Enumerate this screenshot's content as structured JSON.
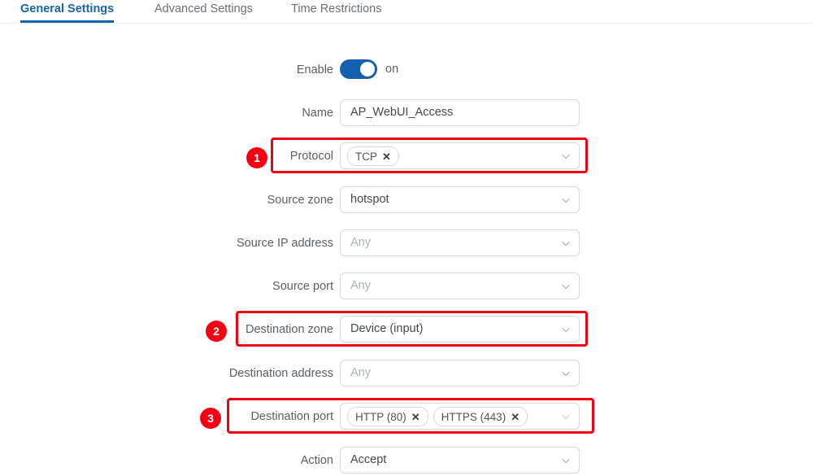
{
  "tabs": [
    {
      "label": "General Settings",
      "active": true
    },
    {
      "label": "Advanced Settings",
      "active": false
    },
    {
      "label": "Time Restrictions",
      "active": false
    }
  ],
  "form": {
    "enable": {
      "label": "Enable",
      "state_text": "on",
      "on": true
    },
    "name": {
      "label": "Name",
      "value": "AP_WebUI_Access"
    },
    "protocol": {
      "label": "Protocol",
      "chips": [
        "TCP"
      ],
      "remove_glyph": "✕"
    },
    "source_zone": {
      "label": "Source zone",
      "value": "hotspot"
    },
    "source_ip_address": {
      "label": "Source IP address",
      "placeholder": "Any"
    },
    "source_port": {
      "label": "Source port",
      "placeholder": "Any"
    },
    "destination_zone": {
      "label": "Destination zone",
      "value": "Device (input)"
    },
    "destination_address": {
      "label": "Destination address",
      "placeholder": "Any"
    },
    "destination_port": {
      "label": "Destination port",
      "chips": [
        "HTTP (80)",
        "HTTPS (443)"
      ],
      "remove_glyph": "✕"
    },
    "action": {
      "label": "Action",
      "value": "Accept"
    }
  },
  "annotations": {
    "badges": [
      "1",
      "2",
      "3"
    ]
  },
  "colors": {
    "accent_blue": "#1565b0",
    "toggle_blue": "#1560ac",
    "annotation_red": "#f50012",
    "field_border": "#d6d9dc",
    "label_text": "#5a5f64",
    "placeholder_text": "#a9b0b8"
  }
}
